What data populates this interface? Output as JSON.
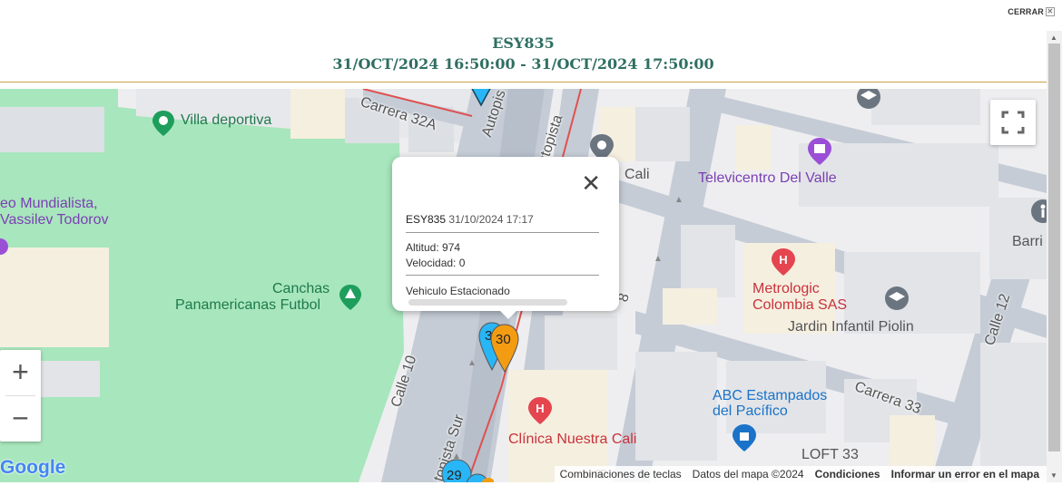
{
  "close_label": "CERRAR",
  "header": {
    "vehicle": "ESY835",
    "range": "31/OCT/2024 16:50:00 - 31/OCT/2024 17:50:00"
  },
  "map": {
    "places": {
      "villa": "Villa deportiva",
      "museo1": "eo Mundialista,",
      "museo2": "Vassilev Todorov",
      "canchas1": "Canchas",
      "canchas2": "Panamericanas Futbol",
      "cali": "Cali",
      "televicentro": "Televicentro Del Valle",
      "barrio": "Barri",
      "metrologic1": "Metrologic",
      "metrologic2": "Colombia SAS",
      "jardin": "Jardin Infantil Piolin",
      "abc1": "ABC Estampados",
      "abc2": "del Pacífico",
      "clinica": "Clínica Nuestra Cali",
      "loft": "LOFT 33"
    },
    "streets": {
      "carrera32a": "Carrera 32A",
      "autopista1": "Autopis",
      "autopista2": "utopista",
      "autopista_sur": "topista Sur",
      "calle10": "Calle 10",
      "calle12": "Calle 12",
      "carrera33": "Carrera 33",
      "a_frag": "A",
      "eight_frag": "8"
    },
    "markers": {
      "m30": "30",
      "m3": "3",
      "m29": "29"
    },
    "zoom_in": "+",
    "zoom_out": "−",
    "google": "Google",
    "attribution": {
      "shortcuts": "Combinaciones de teclas",
      "data": "Datos del mapa ©2024",
      "terms": "Condiciones",
      "report": "Informar un error en el mapa"
    }
  },
  "popup": {
    "vehicle": "ESY835",
    "datetime": "31/10/2024 17:17",
    "altitude": "Altitud: 974",
    "speed": "Velocidad: 0",
    "status": "Vehiculo Estacionado",
    "close": "✕"
  },
  "colors": {
    "header_text": "#2f6f62",
    "header_rule": "#c8a24a",
    "park": "#a8e6bd",
    "road": "#c5ccd6",
    "route": "#e05050",
    "marker_orange": "#f39c12",
    "marker_blue": "#29b6f6"
  }
}
